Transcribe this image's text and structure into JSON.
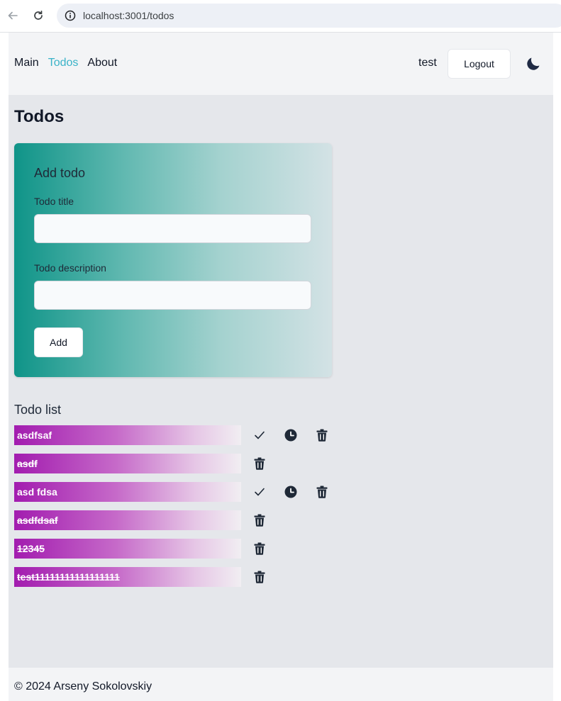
{
  "browser": {
    "url": "localhost:3001/todos"
  },
  "header": {
    "nav": [
      {
        "label": "Main",
        "active": false
      },
      {
        "label": "Todos",
        "active": true
      },
      {
        "label": "About",
        "active": false
      }
    ],
    "username": "test",
    "logout_label": "Logout",
    "theme_icon": "moon-icon"
  },
  "page": {
    "title": "Todos"
  },
  "add_form": {
    "title": "Add todo",
    "title_label": "Todo title",
    "title_value": "",
    "description_label": "Todo description",
    "description_value": "",
    "submit_label": "Add"
  },
  "list": {
    "title": "Todo list",
    "items": [
      {
        "text": "asdfsaf",
        "completed": false
      },
      {
        "text": "asdf",
        "completed": true
      },
      {
        "text": "asd fdsa",
        "completed": false
      },
      {
        "text": "asdfdsaf",
        "completed": true
      },
      {
        "text": "12345",
        "completed": true
      },
      {
        "text": "test11111111111111111",
        "completed": true
      }
    ]
  },
  "footer": {
    "text": "© 2024 Arseny Sokolovskiy"
  },
  "colors": {
    "accent_teal": "#0f9488",
    "accent_purple": "#a21caf",
    "active_nav": "#3ab3c8"
  }
}
